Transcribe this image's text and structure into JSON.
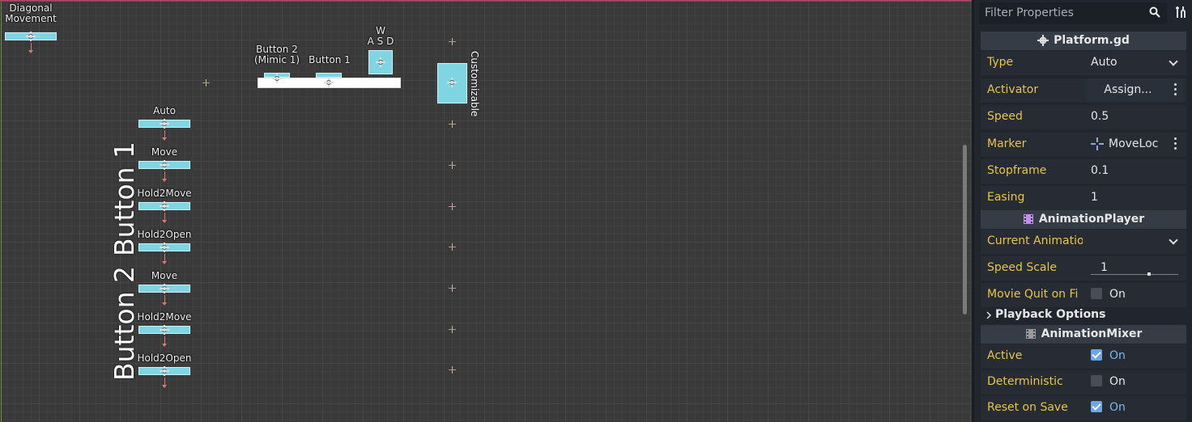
{
  "viewport": {
    "labels": {
      "diagonal": "Diagonal\nMovement",
      "button2_mimic": "Button 2\n(Mimic 1)",
      "button1": "Button 1",
      "wasd": "W\nA S D",
      "customizable": "Customizable",
      "col1": [
        "Auto",
        "Move",
        "Hold2Move",
        "Hold2Open",
        "Move",
        "Hold2Move",
        "Hold2Open"
      ],
      "big_button1": "Button 1",
      "big_button2": "Button 2"
    }
  },
  "inspector": {
    "filter_placeholder": "Filter Properties",
    "script_section": "Platform.gd",
    "props": [
      {
        "label": "Type",
        "value": "Auto"
      },
      {
        "label": "Activator",
        "value": "Assign..."
      },
      {
        "label": "Speed",
        "value": "0.5"
      },
      {
        "label": "Marker",
        "value": "MoveLoc"
      },
      {
        "label": "Stopframe",
        "value": "0.1"
      },
      {
        "label": "Easing",
        "value": "1"
      }
    ],
    "anim_section": "AnimationPlayer",
    "anim_props": [
      {
        "label": "Current Animatio",
        "value": ""
      },
      {
        "label": "Speed Scale",
        "value": "1"
      },
      {
        "label": "Movie Quit on Fi",
        "value": "On"
      }
    ],
    "playback_options": "Playback Options",
    "mixer_section": "AnimationMixer",
    "mixer_props": [
      {
        "label": "Active",
        "value": "On",
        "checked": true
      },
      {
        "label": "Deterministic",
        "value": "On",
        "checked": false
      },
      {
        "label": "Reset on Save",
        "value": "On",
        "checked": true
      }
    ]
  }
}
